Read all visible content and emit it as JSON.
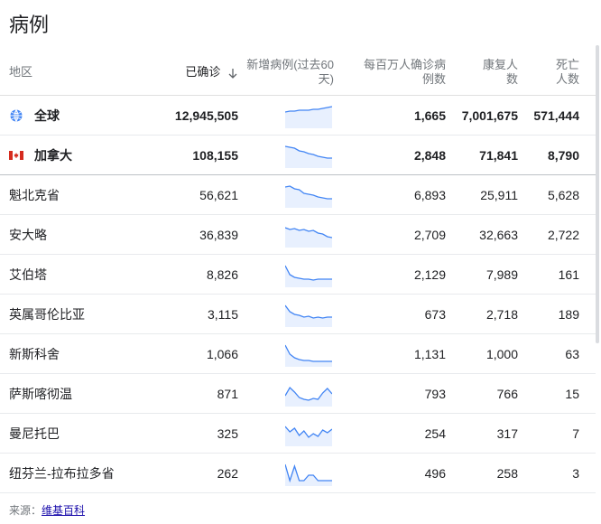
{
  "title": "病例",
  "headers": {
    "region": "地区",
    "confirmed": "已确诊",
    "new_cases_line1": "新增病例(过去60",
    "new_cases_line2": "天)",
    "per_million_line1": "每百万人确诊病",
    "per_million_line2": "例数",
    "recovered_line1": "康复人",
    "recovered_line2": "数",
    "deaths_line1": "死亡",
    "deaths_line2": "人数"
  },
  "rows": [
    {
      "name": "全球",
      "confirmed": "12,945,505",
      "per_million": "1,665",
      "recovered": "7,001,675",
      "deaths": "571,444",
      "icon": "globe-icon",
      "spark": [
        6,
        5,
        5,
        4,
        4,
        4,
        3,
        3,
        2,
        1,
        0
      ]
    },
    {
      "name": "加拿大",
      "confirmed": "108,155",
      "per_million": "2,848",
      "recovered": "71,841",
      "deaths": "8,790",
      "icon": "canada-flag-icon",
      "spark": [
        0,
        1,
        2,
        5,
        6,
        8,
        9,
        11,
        12,
        13,
        13
      ]
    },
    {
      "name": "魁北克省",
      "confirmed": "56,621",
      "per_million": "6,893",
      "recovered": "25,911",
      "deaths": "5,628",
      "spark": [
        1,
        0,
        3,
        4,
        8,
        9,
        10,
        12,
        13,
        14,
        14
      ]
    },
    {
      "name": "安大略",
      "confirmed": "36,839",
      "per_million": "2,709",
      "recovered": "32,663",
      "deaths": "2,722",
      "spark": [
        2,
        4,
        3,
        5,
        4,
        6,
        5,
        8,
        9,
        12,
        13
      ]
    },
    {
      "name": "艾伯塔",
      "confirmed": "8,826",
      "per_million": "2,129",
      "recovered": "7,989",
      "deaths": "161",
      "spark": [
        0,
        10,
        13,
        14,
        15,
        15,
        16,
        15,
        15,
        15,
        15
      ]
    },
    {
      "name": "英属哥伦比亚",
      "confirmed": "3,115",
      "per_million": "673",
      "recovered": "2,718",
      "deaths": "189",
      "spark": [
        0,
        7,
        10,
        11,
        13,
        12,
        14,
        13,
        14,
        13,
        13
      ]
    },
    {
      "name": "新斯科舍",
      "confirmed": "1,066",
      "per_million": "1,131",
      "recovered": "1,000",
      "deaths": "63",
      "spark": [
        0,
        10,
        14,
        16,
        17,
        17,
        18,
        18,
        18,
        18,
        18
      ]
    },
    {
      "name": "萨斯喀彻温",
      "confirmed": "871",
      "per_million": "793",
      "recovered": "766",
      "deaths": "15",
      "spark": [
        12,
        3,
        8,
        14,
        16,
        17,
        15,
        16,
        9,
        4,
        10
      ]
    },
    {
      "name": "曼尼托巴",
      "confirmed": "325",
      "per_million": "254",
      "recovered": "317",
      "deaths": "7",
      "spark": [
        2,
        8,
        4,
        12,
        7,
        14,
        10,
        13,
        6,
        9,
        5
      ]
    },
    {
      "name": "纽芬兰-拉布拉多省",
      "confirmed": "262",
      "per_million": "496",
      "recovered": "258",
      "deaths": "3",
      "spark": [
        0,
        18,
        2,
        18,
        18,
        12,
        12,
        18,
        18,
        18,
        18
      ]
    }
  ],
  "source_label": "来源：",
  "source_link": "维基百科",
  "colors": {
    "spark_line": "#4285f4",
    "spark_fill": "#e8f0fe"
  }
}
